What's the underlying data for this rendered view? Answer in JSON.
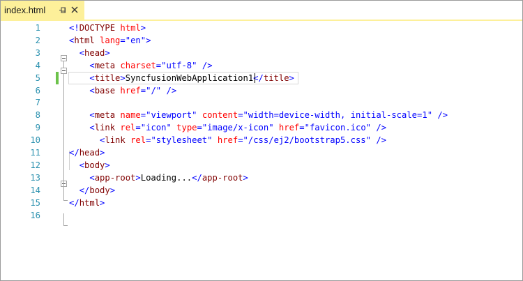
{
  "tab": {
    "title": "index.html",
    "pin_icon": "pin-icon",
    "close_icon": "close-icon",
    "accent_color": "#fdf09a"
  },
  "editor": {
    "lines": [
      {
        "n": "1",
        "text": "<!DOCTYPE html>"
      },
      {
        "n": "2",
        "text": "<html lang=\"en\">"
      },
      {
        "n": "3",
        "text": "  <head>"
      },
      {
        "n": "4",
        "text": "    <meta charset=\"utf-8\" />"
      },
      {
        "n": "5",
        "text": "    <title>SyncfusionWebApplication1</title>"
      },
      {
        "n": "6",
        "text": "    <base href=\"/\" />"
      },
      {
        "n": "7",
        "text": ""
      },
      {
        "n": "8",
        "text": "    <meta name=\"viewport\" content=\"width=device-width, initial-scale=1\" />"
      },
      {
        "n": "9",
        "text": "    <link rel=\"icon\" type=\"image/x-icon\" href=\"favicon.ico\" />"
      },
      {
        "n": "10",
        "text": "      <link rel=\"stylesheet\" href=\"/css/ej2/bootstrap5.css\" />"
      },
      {
        "n": "11",
        "text": "</head>"
      },
      {
        "n": "12",
        "text": "  <body>"
      },
      {
        "n": "13",
        "text": "    <app-root>Loading...</app-root>"
      },
      {
        "n": "14",
        "text": "  </body>"
      },
      {
        "n": "15",
        "text": "</html>"
      },
      {
        "n": "16",
        "text": ""
      }
    ],
    "current_line": "5",
    "modified_line": "5",
    "colors": {
      "line_number": "#2b91af",
      "punctuation": "#0000ff",
      "tag": "#800000",
      "attribute": "#ff0000",
      "value": "#0000ff",
      "modified_marker": "#6cc24a"
    }
  }
}
